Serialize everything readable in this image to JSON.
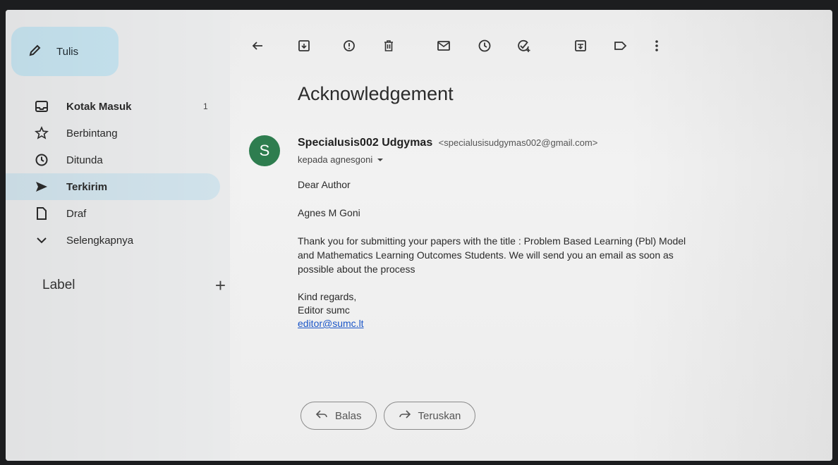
{
  "compose": {
    "label": "Tulis",
    "icon": "pencil-icon"
  },
  "nav": [
    {
      "label": "Kotak Masuk",
      "icon": "inbox-icon",
      "count": "1",
      "bold": true,
      "active": false
    },
    {
      "label": "Berbintang",
      "icon": "star-icon",
      "count": "",
      "bold": false,
      "active": false
    },
    {
      "label": "Ditunda",
      "icon": "clock-icon",
      "count": "",
      "bold": false,
      "active": false
    },
    {
      "label": "Terkirim",
      "icon": "send-icon",
      "count": "",
      "bold": true,
      "active": true
    },
    {
      "label": "Draf",
      "icon": "draft-icon",
      "count": "",
      "bold": false,
      "active": false
    },
    {
      "label": "Selengkapnya",
      "icon": "chevron-down-icon",
      "count": "",
      "bold": false,
      "active": false
    }
  ],
  "labels": {
    "title": "Label",
    "add_icon": "plus-icon"
  },
  "toolbar": [
    "back-arrow-icon",
    "archive-icon",
    "report-spam-icon",
    "delete-icon",
    "mark-unread-icon",
    "snooze-icon",
    "add-task-icon",
    "move-to-icon",
    "label-icon",
    "more-vert-icon"
  ],
  "message": {
    "subject": "Acknowledgement",
    "avatar_letter": "S",
    "avatar_color": "#2e7d4f",
    "sender_name": "Specialusis002 Udgymas",
    "sender_email": "<specialusisudgymas002@gmail.com>",
    "to_line": "kepada agnesgoni",
    "greeting": "Dear Author",
    "recipient_name": "Agnes M Goni",
    "paragraph": "Thank you for submitting your papers with the title : Problem Based Learning (Pbl) Model and Mathematics Learning Outcomes Students.  We will send you an email as soon as possible about the process",
    "closing": "Kind regards,",
    "signature": "Editor sumc",
    "signature_email": "editor@sumc.lt"
  },
  "actions": {
    "reply": "Balas",
    "forward": "Teruskan"
  },
  "colors": {
    "accent": "#c6e3ef",
    "active_nav": "#d1e3ec",
    "link": "#1a55c8"
  }
}
